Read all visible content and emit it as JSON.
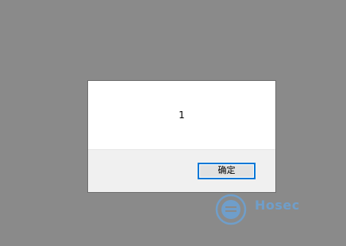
{
  "dialog": {
    "message": "1",
    "ok_label": "确定"
  },
  "watermark": {
    "name": "Hosec",
    "colors": {
      "accent": "#5ab0ff"
    }
  },
  "colors": {
    "backdrop": "#8a8a8a",
    "dialog_bg": "#ffffff",
    "footer_bg": "#f0f0f0",
    "button_focus_border": "#0078d7"
  }
}
